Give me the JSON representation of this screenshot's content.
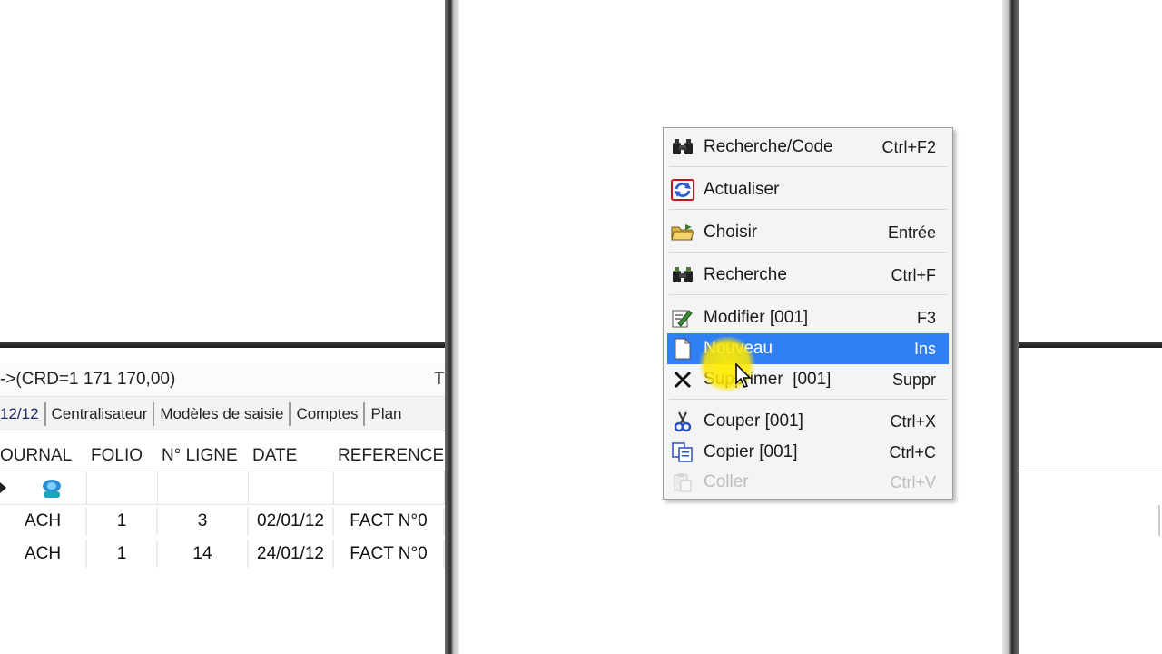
{
  "status": {
    "text": "->(CRD=1 171 170,00)",
    "tail": "T"
  },
  "tabs": [
    {
      "label": "12/12",
      "active": true
    },
    {
      "label": "Centralisateur"
    },
    {
      "label": "Modèles de saisie"
    },
    {
      "label": "Comptes"
    },
    {
      "label": "Plan"
    }
  ],
  "grid": {
    "columns": [
      "OURNAL",
      "FOLIO",
      "N° LIGNE",
      "DATE",
      "REFERENCE"
    ],
    "rows": [
      {
        "journal": "ACH",
        "folio": "1",
        "ligne": "3",
        "date": "02/01/12",
        "reference": "FACT N°0"
      },
      {
        "journal": "ACH",
        "folio": "1",
        "ligne": "14",
        "date": "24/01/12",
        "reference": "FACT N°0"
      }
    ]
  },
  "context_menu": {
    "items": [
      {
        "icon": "binoculars-code-icon",
        "label": "Recherche/Code",
        "shortcut": "Ctrl+F2"
      },
      {
        "icon": "refresh-icon",
        "label": "Actualiser",
        "shortcut": ""
      },
      {
        "icon": "folder-open-icon",
        "label": "Choisir",
        "shortcut": "Entrée"
      },
      {
        "icon": "binoculars-icon",
        "label": "Recherche",
        "shortcut": "Ctrl+F"
      },
      {
        "icon": "edit-icon",
        "label": "Modifier [001]",
        "shortcut": "F3"
      },
      {
        "icon": "new-document-icon",
        "label": "Nouveau",
        "shortcut": "Ins",
        "highlighted": true
      },
      {
        "icon": "delete-x-icon",
        "label": "Supprimer  [001]",
        "shortcut": "Suppr"
      },
      {
        "icon": "scissors-icon",
        "label": "Couper [001]",
        "shortcut": "Ctrl+X"
      },
      {
        "icon": "copy-icon",
        "label": "Copier [001]",
        "shortcut": "Ctrl+C"
      },
      {
        "icon": "paste-icon",
        "label": "Coller",
        "shortcut": "Ctrl+V",
        "disabled": true
      }
    ]
  },
  "colors": {
    "highlight": "#2f7ff5",
    "cursor_glow": "#ffee00"
  }
}
